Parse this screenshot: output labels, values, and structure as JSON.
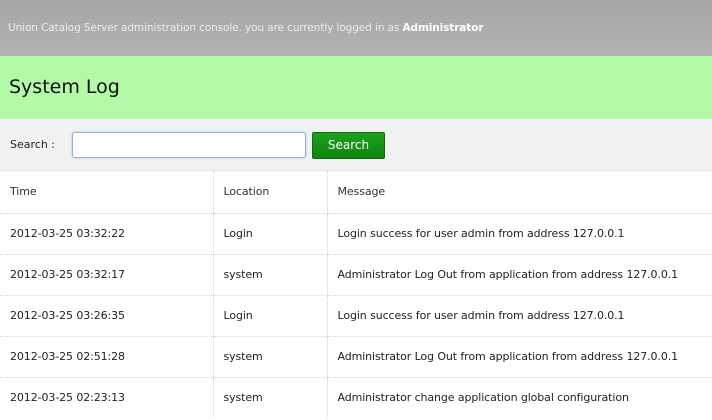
{
  "header": {
    "banner_text": "Union Catalog Server administration console. you are currently logged in as ",
    "user": "Administrator"
  },
  "page": {
    "title": "System Log"
  },
  "search": {
    "label": "Search :",
    "value": "",
    "placeholder": "",
    "button_label": "Search"
  },
  "table": {
    "columns": [
      "Time",
      "Location",
      "Message"
    ],
    "rows": [
      {
        "time": "2012-03-25 03:32:22",
        "location": "Login",
        "message": "Login success for user admin from address 127.0.0.1"
      },
      {
        "time": "2012-03-25 03:32:17",
        "location": "system",
        "message": "Administrator Log Out from application from address 127.0.0.1"
      },
      {
        "time": "2012-03-25 03:26:35",
        "location": "Login",
        "message": "Login success for user admin from address 127.0.0.1"
      },
      {
        "time": "2012-03-25 02:51:28",
        "location": "system",
        "message": "Administrator Log Out from application from address 127.0.0.1"
      },
      {
        "time": "2012-03-25 02:23:13",
        "location": "system",
        "message": "Administrator change application global configuration"
      }
    ]
  },
  "colors": {
    "header_bg": "#a9a9a9",
    "title_bg": "#b4f9a8",
    "search_bg": "#f2f2f2",
    "button_bg": "#169216"
  }
}
